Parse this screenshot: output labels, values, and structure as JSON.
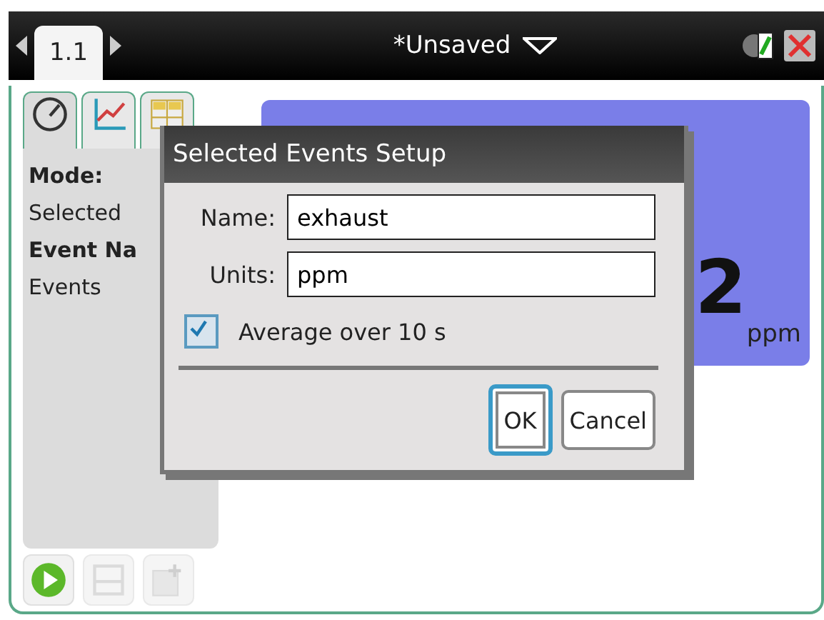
{
  "top_bar": {
    "page_tab": "1.1",
    "document_title": "*Unsaved"
  },
  "app_tabs": [
    {
      "kind": "meter",
      "selected": true
    },
    {
      "kind": "graph",
      "selected": false
    },
    {
      "kind": "table",
      "selected": false
    }
  ],
  "side_panel": [
    {
      "text": "Mode:",
      "bold": true
    },
    {
      "text": "Selected",
      "bold": false
    },
    {
      "text": "Event Na",
      "bold": true
    },
    {
      "text": "Events",
      "bold": false
    }
  ],
  "meter": {
    "value": "2",
    "unit": "ppm"
  },
  "dialog": {
    "title": "Selected Events Setup",
    "fields": [
      {
        "label": "Name:",
        "value": "exhaust"
      },
      {
        "label": "Units:",
        "value": "ppm"
      }
    ],
    "checkbox": {
      "label": "Average over 10 s",
      "checked": true
    },
    "buttons": [
      {
        "label": "OK",
        "focused": true
      },
      {
        "label": "Cancel",
        "focused": false
      }
    ]
  },
  "bottom_tools": [
    {
      "kind": "play",
      "disabled": false
    },
    {
      "kind": "mark",
      "disabled": true
    },
    {
      "kind": "keep",
      "disabled": true
    }
  ]
}
